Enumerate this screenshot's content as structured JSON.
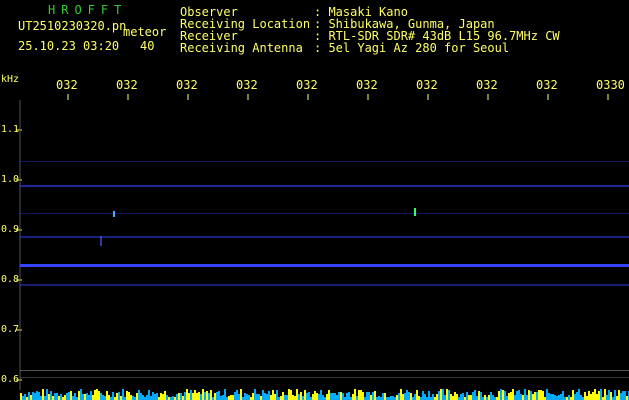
{
  "header": {
    "brand": "HROFFT",
    "filename": "UT2510230320.pn",
    "mode": "meteor",
    "datetime": "25.10.23 03:20",
    "count": "40",
    "fields": [
      {
        "label": "Observer",
        "value": ": Masaki Kano"
      },
      {
        "label": "Receiving Location",
        "value": ": Shibukawa, Gunma, Japan"
      },
      {
        "label": "Receiver",
        "value": ": RTL-SDR SDR# 43dB L15 96.7MHz CW"
      },
      {
        "label": "Receiving Antenna",
        "value": ": 5el Yagi Az 280 for Seoul"
      }
    ]
  },
  "axis": {
    "y_unit": "kHz",
    "y_ticks": [
      "1.1",
      "1.0",
      "0.9",
      "0.8",
      "0.7",
      "0.6"
    ],
    "x_ticks": [
      "032",
      "032",
      "032",
      "032",
      "032",
      "032",
      "032",
      "032",
      "032",
      "0330"
    ]
  },
  "colors": {
    "text": "#ffff66",
    "brand": "#33cc33",
    "signal": "#3344ff",
    "grid": "#2a2a2a",
    "noise_low": "#00aaff",
    "noise_high": "#ffff00"
  }
}
